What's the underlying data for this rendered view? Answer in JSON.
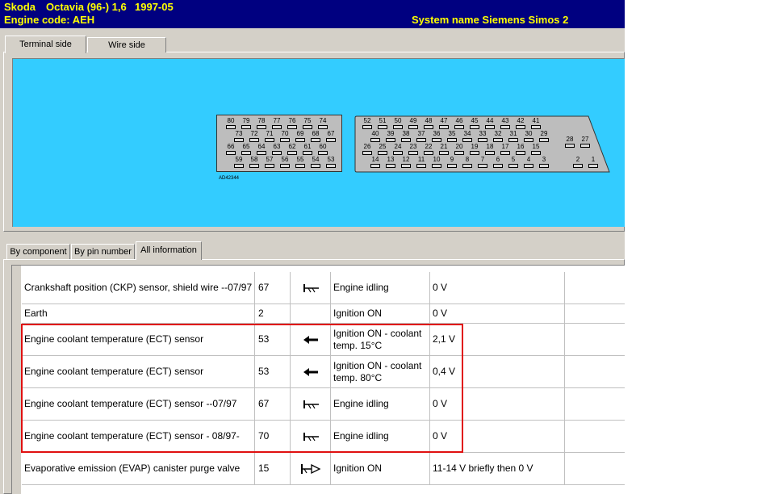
{
  "title": {
    "make": "Skoda",
    "model": "Octavia (96-) 1,6",
    "year": "1997-05",
    "engine_code": "Engine code: AEH",
    "system_name": "System name Siemens Simos 2"
  },
  "view_tabs": [
    "Terminal side",
    "Wire side"
  ],
  "diagram": {
    "code": "AD42344",
    "left_rows": [
      [
        "80",
        "79",
        "78",
        "77",
        "76",
        "75",
        "74"
      ],
      [
        "73",
        "72",
        "71",
        "70",
        "69",
        "68",
        "67"
      ],
      [
        "66",
        "65",
        "64",
        "63",
        "62",
        "61",
        "60"
      ],
      [
        "59",
        "58",
        "57",
        "56",
        "55",
        "54",
        "53"
      ]
    ],
    "right_rows": [
      [
        "52",
        "51",
        "50",
        "49",
        "48",
        "47",
        "46",
        "45",
        "44",
        "43",
        "42",
        "41"
      ],
      [
        "40",
        "39",
        "38",
        "37",
        "36",
        "35",
        "34",
        "33",
        "32",
        "31",
        "30",
        "29"
      ],
      [
        "26",
        "25",
        "24",
        "23",
        "22",
        "21",
        "20",
        "19",
        "18",
        "17",
        "16",
        "15"
      ],
      [
        "14",
        "13",
        "12",
        "11",
        "10",
        "9",
        "8",
        "7",
        "6",
        "5",
        "4",
        "3"
      ]
    ],
    "side_pins": [
      "28",
      "27",
      "2",
      "1"
    ],
    "background": "#33ccff"
  },
  "info_tabs": [
    "By component",
    "By pin number",
    "All information"
  ],
  "rows": [
    {
      "component": "Crankshaft position (CKP) sensor, shield wire --07/97",
      "pin": "67",
      "symbol": "ground-icon",
      "condition": "Engine idling",
      "value": "0 V"
    },
    {
      "component": "Earth",
      "pin": "2",
      "symbol": "",
      "condition": "Ignition ON",
      "value": "0 V"
    },
    {
      "component": "Engine coolant temperature (ECT) sensor",
      "pin": "53",
      "symbol": "arrow-left-icon",
      "condition": "Ignition ON - coolant temp. 15°C",
      "value": "2,1 V"
    },
    {
      "component": "Engine coolant temperature (ECT) sensor",
      "pin": "53",
      "symbol": "arrow-left-icon",
      "condition": "Ignition ON - coolant temp. 80°C",
      "value": "0,4 V"
    },
    {
      "component": "Engine coolant temperature (ECT) sensor --07/97",
      "pin": "67",
      "symbol": "ground-icon",
      "condition": "Engine idling",
      "value": "0 V"
    },
    {
      "component": "Engine coolant temperature (ECT) sensor - 08/97-",
      "pin": "70",
      "symbol": "ground-icon",
      "condition": "Engine idling",
      "value": "0 V"
    },
    {
      "component": "Evaporative emission (EVAP) canister purge valve",
      "pin": "15",
      "symbol": "output-icon",
      "condition": "Ignition ON",
      "value": "11-14 V briefly then 0 V"
    }
  ],
  "highlight_color": "#e01010"
}
